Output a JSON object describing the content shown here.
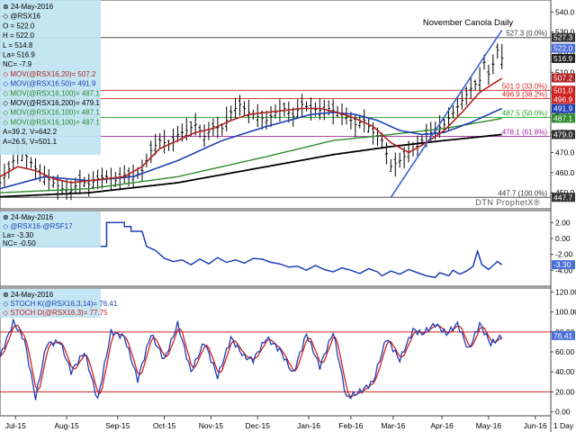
{
  "chart_data": [
    {
      "type": "line",
      "title": "November Canola Daily",
      "watermark": "DTN ProphetX®",
      "date": "24-May-2016",
      "symbol": "@RSX16",
      "quote": {
        "O": "O = 522.0",
        "H": "H = 522.0",
        "L": "L = 514.8",
        "La": "La= 516.9",
        "NC": "NC= -7.9"
      },
      "legend": [
        {
          "label": "MOV(@RSX16,20)= 507.2",
          "color": "#b22222"
        },
        {
          "label": "MOV(@RSX16,50)= 491.9",
          "color": "#1f3fb4"
        },
        {
          "label": "MOV(@RSX16,100)= 487.1",
          "color": "#2e8b2e"
        },
        {
          "label": "MOV(@RSX16,200)= 479.1",
          "color": "#000000"
        },
        {
          "label": "MOV(@RSX16,100)= 487.1",
          "color": "#2e8b2e"
        },
        {
          "label": "MOV(@RSX16,100)= 487.1",
          "color": "#2e8b2e"
        },
        {
          "label": "A=39.2, V=642.2",
          "color": "#000000"
        },
        {
          "label": "A=26.5, V=501.1",
          "color": "#000000"
        }
      ],
      "y_ticks": [
        450,
        460,
        470,
        480,
        490,
        500,
        510,
        520,
        530,
        540
      ],
      "ylim": [
        442,
        546
      ],
      "fib_levels": [
        {
          "value": 527.3,
          "label": "527.3 (0.0%)",
          "color": "#333333"
        },
        {
          "value": 501.0,
          "label": "501.0 (33.0%)",
          "color": "#d02020"
        },
        {
          "value": 496.9,
          "label": "496.9 (38.2%)",
          "color": "#d02020"
        },
        {
          "value": 487.5,
          "label": "487.5 (50.0%)",
          "color": "#20a020"
        },
        {
          "value": 478.1,
          "label": "478.1 (61.8%)",
          "color": "#a020a0"
        },
        {
          "value": 447.7,
          "label": "447.7 (100.0%)",
          "color": "#333333"
        }
      ],
      "price_boxes": [
        {
          "label": "527.3",
          "value": 527.3,
          "color": "#333333"
        },
        {
          "label": "522.0",
          "value": 522.0,
          "color": "#4a6fd8"
        },
        {
          "label": "516.9",
          "value": 516.9,
          "color": "#222222"
        },
        {
          "label": "507.2",
          "value": 507.2,
          "color": "#b22222"
        },
        {
          "label": "501.0",
          "value": 501.0,
          "color": "#d02020"
        },
        {
          "label": "496.9",
          "value": 496.9,
          "color": "#d02020"
        },
        {
          "label": "491.9",
          "value": 491.9,
          "color": "#1f3fb4"
        },
        {
          "label": "487.1",
          "value": 487.1,
          "color": "#2e8b2e"
        },
        {
          "label": "479.0",
          "value": 479.0,
          "color": "#333333"
        },
        {
          "label": "447.7",
          "value": 447.7,
          "color": "#333333"
        }
      ],
      "trendline": {
        "start": {
          "x": 176,
          "y": 447.7
        },
        "end": {
          "x": 226,
          "y": 531
        }
      },
      "close_anchors": [
        [
          0,
          455
        ],
        [
          4,
          462
        ],
        [
          8,
          470
        ],
        [
          12,
          468
        ],
        [
          16,
          462
        ],
        [
          20,
          458
        ],
        [
          24,
          455
        ],
        [
          28,
          452
        ],
        [
          32,
          451
        ],
        [
          36,
          456
        ],
        [
          40,
          454
        ],
        [
          44,
          457
        ],
        [
          48,
          458
        ],
        [
          52,
          456
        ],
        [
          56,
          459
        ],
        [
          60,
          458
        ],
        [
          64,
          461
        ],
        [
          68,
          471
        ],
        [
          72,
          476
        ],
        [
          76,
          474
        ],
        [
          80,
          479
        ],
        [
          84,
          481
        ],
        [
          88,
          484
        ],
        [
          92,
          478
        ],
        [
          96,
          483
        ],
        [
          100,
          482
        ],
        [
          104,
          490
        ],
        [
          108,
          494
        ],
        [
          112,
          490
        ],
        [
          116,
          488
        ],
        [
          120,
          486
        ],
        [
          124,
          490
        ],
        [
          128,
          492
        ],
        [
          132,
          488
        ],
        [
          136,
          494
        ],
        [
          140,
          492
        ],
        [
          144,
          491
        ],
        [
          148,
          492
        ],
        [
          152,
          490
        ],
        [
          156,
          488
        ],
        [
          160,
          484
        ],
        [
          164,
          486
        ],
        [
          168,
          480
        ],
        [
          172,
          476
        ],
        [
          176,
          463
        ],
        [
          180,
          466
        ],
        [
          184,
          470
        ],
        [
          188,
          473
        ],
        [
          192,
          479
        ],
        [
          196,
          481
        ],
        [
          200,
          484
        ],
        [
          204,
          490
        ],
        [
          208,
          496
        ],
        [
          212,
          502
        ],
        [
          216,
          506
        ],
        [
          218,
          515
        ],
        [
          220,
          509
        ],
        [
          222,
          514
        ],
        [
          224,
          521
        ],
        [
          226,
          517
        ]
      ],
      "ma_anchors": {
        "ma20": [
          [
            0,
            458
          ],
          [
            8,
            463
          ],
          [
            16,
            461
          ],
          [
            24,
            457
          ],
          [
            32,
            455
          ],
          [
            40,
            456
          ],
          [
            48,
            457
          ],
          [
            56,
            458
          ],
          [
            64,
            463
          ],
          [
            72,
            472
          ],
          [
            80,
            476
          ],
          [
            88,
            480
          ],
          [
            96,
            482
          ],
          [
            104,
            486
          ],
          [
            112,
            489
          ],
          [
            120,
            490
          ],
          [
            128,
            491
          ],
          [
            136,
            492
          ],
          [
            144,
            492
          ],
          [
            152,
            490
          ],
          [
            160,
            487
          ],
          [
            168,
            483
          ],
          [
            176,
            475
          ],
          [
            184,
            470
          ],
          [
            192,
            475
          ],
          [
            200,
            481
          ],
          [
            208,
            490
          ],
          [
            216,
            500
          ],
          [
            226,
            507
          ]
        ],
        "ma50": [
          [
            0,
            452
          ],
          [
            20,
            458
          ],
          [
            40,
            456
          ],
          [
            60,
            458
          ],
          [
            80,
            466
          ],
          [
            100,
            476
          ],
          [
            120,
            483
          ],
          [
            140,
            489
          ],
          [
            150,
            490
          ],
          [
            160,
            489
          ],
          [
            170,
            486
          ],
          [
            180,
            481
          ],
          [
            190,
            479
          ],
          [
            200,
            480
          ],
          [
            212,
            485
          ],
          [
            226,
            492
          ]
        ],
        "ma100": [
          [
            0,
            450
          ],
          [
            40,
            452
          ],
          [
            80,
            458
          ],
          [
            120,
            468
          ],
          [
            150,
            476
          ],
          [
            176,
            479
          ],
          [
            200,
            482
          ],
          [
            226,
            487
          ]
        ],
        "ma200": [
          [
            0,
            448
          ],
          [
            40,
            450
          ],
          [
            80,
            455
          ],
          [
            120,
            463
          ],
          [
            150,
            469
          ],
          [
            176,
            473
          ],
          [
            200,
            476
          ],
          [
            226,
            479
          ]
        ]
      }
    },
    {
      "type": "line",
      "date": "24-May-2016",
      "label": "@RSX16-@RSF17",
      "stats": {
        "La": "La= -3.30",
        "NC": "NC= -0.50"
      },
      "y_ticks": [
        2.0,
        0.0,
        -2.0,
        -4.0
      ],
      "ylim": [
        -6,
        3.5
      ],
      "last_value": "-3.30",
      "series": [
        {
          "name": "@RSX16-@RSF17",
          "color": "#1f3fb4",
          "points": [
            [
              0,
              -1.0
            ],
            [
              46,
              -1.0
            ],
            [
              48,
              -1.0
            ],
            [
              48,
              2.0
            ],
            [
              56,
              2.0
            ],
            [
              56,
              1.5
            ],
            [
              59,
              1.5
            ],
            [
              59,
              0.9
            ],
            [
              64,
              0.9
            ],
            [
              66,
              -1.0
            ],
            [
              70,
              -1.5
            ],
            [
              74,
              -2.5
            ],
            [
              78,
              -2.9
            ],
            [
              82,
              -2.7
            ],
            [
              86,
              -3.3
            ],
            [
              90,
              -2.6
            ],
            [
              94,
              -3.2
            ],
            [
              98,
              -2.4
            ],
            [
              102,
              -3.0
            ],
            [
              106,
              -2.7
            ],
            [
              110,
              -3.1
            ],
            [
              114,
              -2.5
            ],
            [
              118,
              -2.6
            ],
            [
              122,
              -3.0
            ],
            [
              126,
              -3.2
            ],
            [
              130,
              -3.6
            ],
            [
              134,
              -3.5
            ],
            [
              138,
              -4.0
            ],
            [
              142,
              -3.4
            ],
            [
              146,
              -3.9
            ],
            [
              150,
              -4.2
            ],
            [
              154,
              -3.7
            ],
            [
              158,
              -4.0
            ],
            [
              162,
              -4.4
            ],
            [
              166,
              -3.8
            ],
            [
              170,
              -4.2
            ],
            [
              172,
              -4.7
            ],
            [
              176,
              -4.1
            ],
            [
              180,
              -4.5
            ],
            [
              184,
              -3.9
            ],
            [
              188,
              -4.3
            ],
            [
              192,
              -4.7
            ],
            [
              196,
              -4.9
            ],
            [
              198,
              -4.3
            ],
            [
              202,
              -4.7
            ],
            [
              204,
              -4.0
            ],
            [
              207,
              -4.5
            ],
            [
              210,
              -4.1
            ],
            [
              213,
              -3.5
            ],
            [
              215,
              -1.6
            ],
            [
              217,
              -3.3
            ],
            [
              220,
              -3.9
            ],
            [
              222,
              -3.4
            ],
            [
              224,
              -2.9
            ],
            [
              226,
              -3.3
            ]
          ]
        }
      ]
    },
    {
      "type": "line",
      "date": "24-May-2016",
      "legend": [
        {
          "label": "STOCH K(@RSX16,3,14)= 76.41",
          "color": "#1f3fb4"
        },
        {
          "label": "STOCH D(@RSX16,3)= 77.75",
          "color": "#d02020"
        }
      ],
      "y_ticks": [
        0,
        20,
        40,
        60,
        80,
        100,
        120
      ],
      "ylim": [
        -4,
        124
      ],
      "ref_lines": [
        80,
        20
      ],
      "last_value": "76.41",
      "stoch_anchors": [
        [
          0,
          55
        ],
        [
          6,
          90
        ],
        [
          11,
          72
        ],
        [
          16,
          14
        ],
        [
          21,
          68
        ],
        [
          27,
          70
        ],
        [
          32,
          40
        ],
        [
          38,
          60
        ],
        [
          44,
          12
        ],
        [
          50,
          80
        ],
        [
          56,
          75
        ],
        [
          62,
          32
        ],
        [
          68,
          78
        ],
        [
          74,
          52
        ],
        [
          80,
          88
        ],
        [
          86,
          40
        ],
        [
          92,
          70
        ],
        [
          98,
          35
        ],
        [
          104,
          74
        ],
        [
          110,
          55
        ],
        [
          114,
          52
        ],
        [
          120,
          74
        ],
        [
          126,
          62
        ],
        [
          132,
          38
        ],
        [
          138,
          78
        ],
        [
          144,
          45
        ],
        [
          150,
          80
        ],
        [
          156,
          14
        ],
        [
          162,
          20
        ],
        [
          168,
          30
        ],
        [
          174,
          74
        ],
        [
          180,
          52
        ],
        [
          186,
          82
        ],
        [
          190,
          78
        ],
        [
          196,
          88
        ],
        [
          201,
          78
        ],
        [
          206,
          88
        ],
        [
          211,
          62
        ],
        [
          216,
          88
        ],
        [
          221,
          68
        ],
        [
          226,
          76
        ]
      ]
    }
  ],
  "x_axis": {
    "labels": [
      {
        "x": 7,
        "label": "Jul-15"
      },
      {
        "x": 30,
        "label": "Aug-15"
      },
      {
        "x": 53,
        "label": "Sep-15"
      },
      {
        "x": 74,
        "label": "Oct-15"
      },
      {
        "x": 95,
        "label": "Nov-15"
      },
      {
        "x": 116,
        "label": "Dec-15"
      },
      {
        "x": 139,
        "label": "Jan-16"
      },
      {
        "x": 158,
        "label": "Feb-16"
      },
      {
        "x": 177,
        "label": "Mar-16"
      },
      {
        "x": 199,
        "label": "Apr-16"
      },
      {
        "x": 220,
        "label": "May-16"
      },
      {
        "x": 241,
        "label": "Jun-16"
      }
    ],
    "xlim": [
      0,
      248
    ],
    "period": "1 Day"
  },
  "colors": {
    "legend_box": "#bfe4f2",
    "candle": "#000000",
    "trendline": "#3a63d6"
  }
}
